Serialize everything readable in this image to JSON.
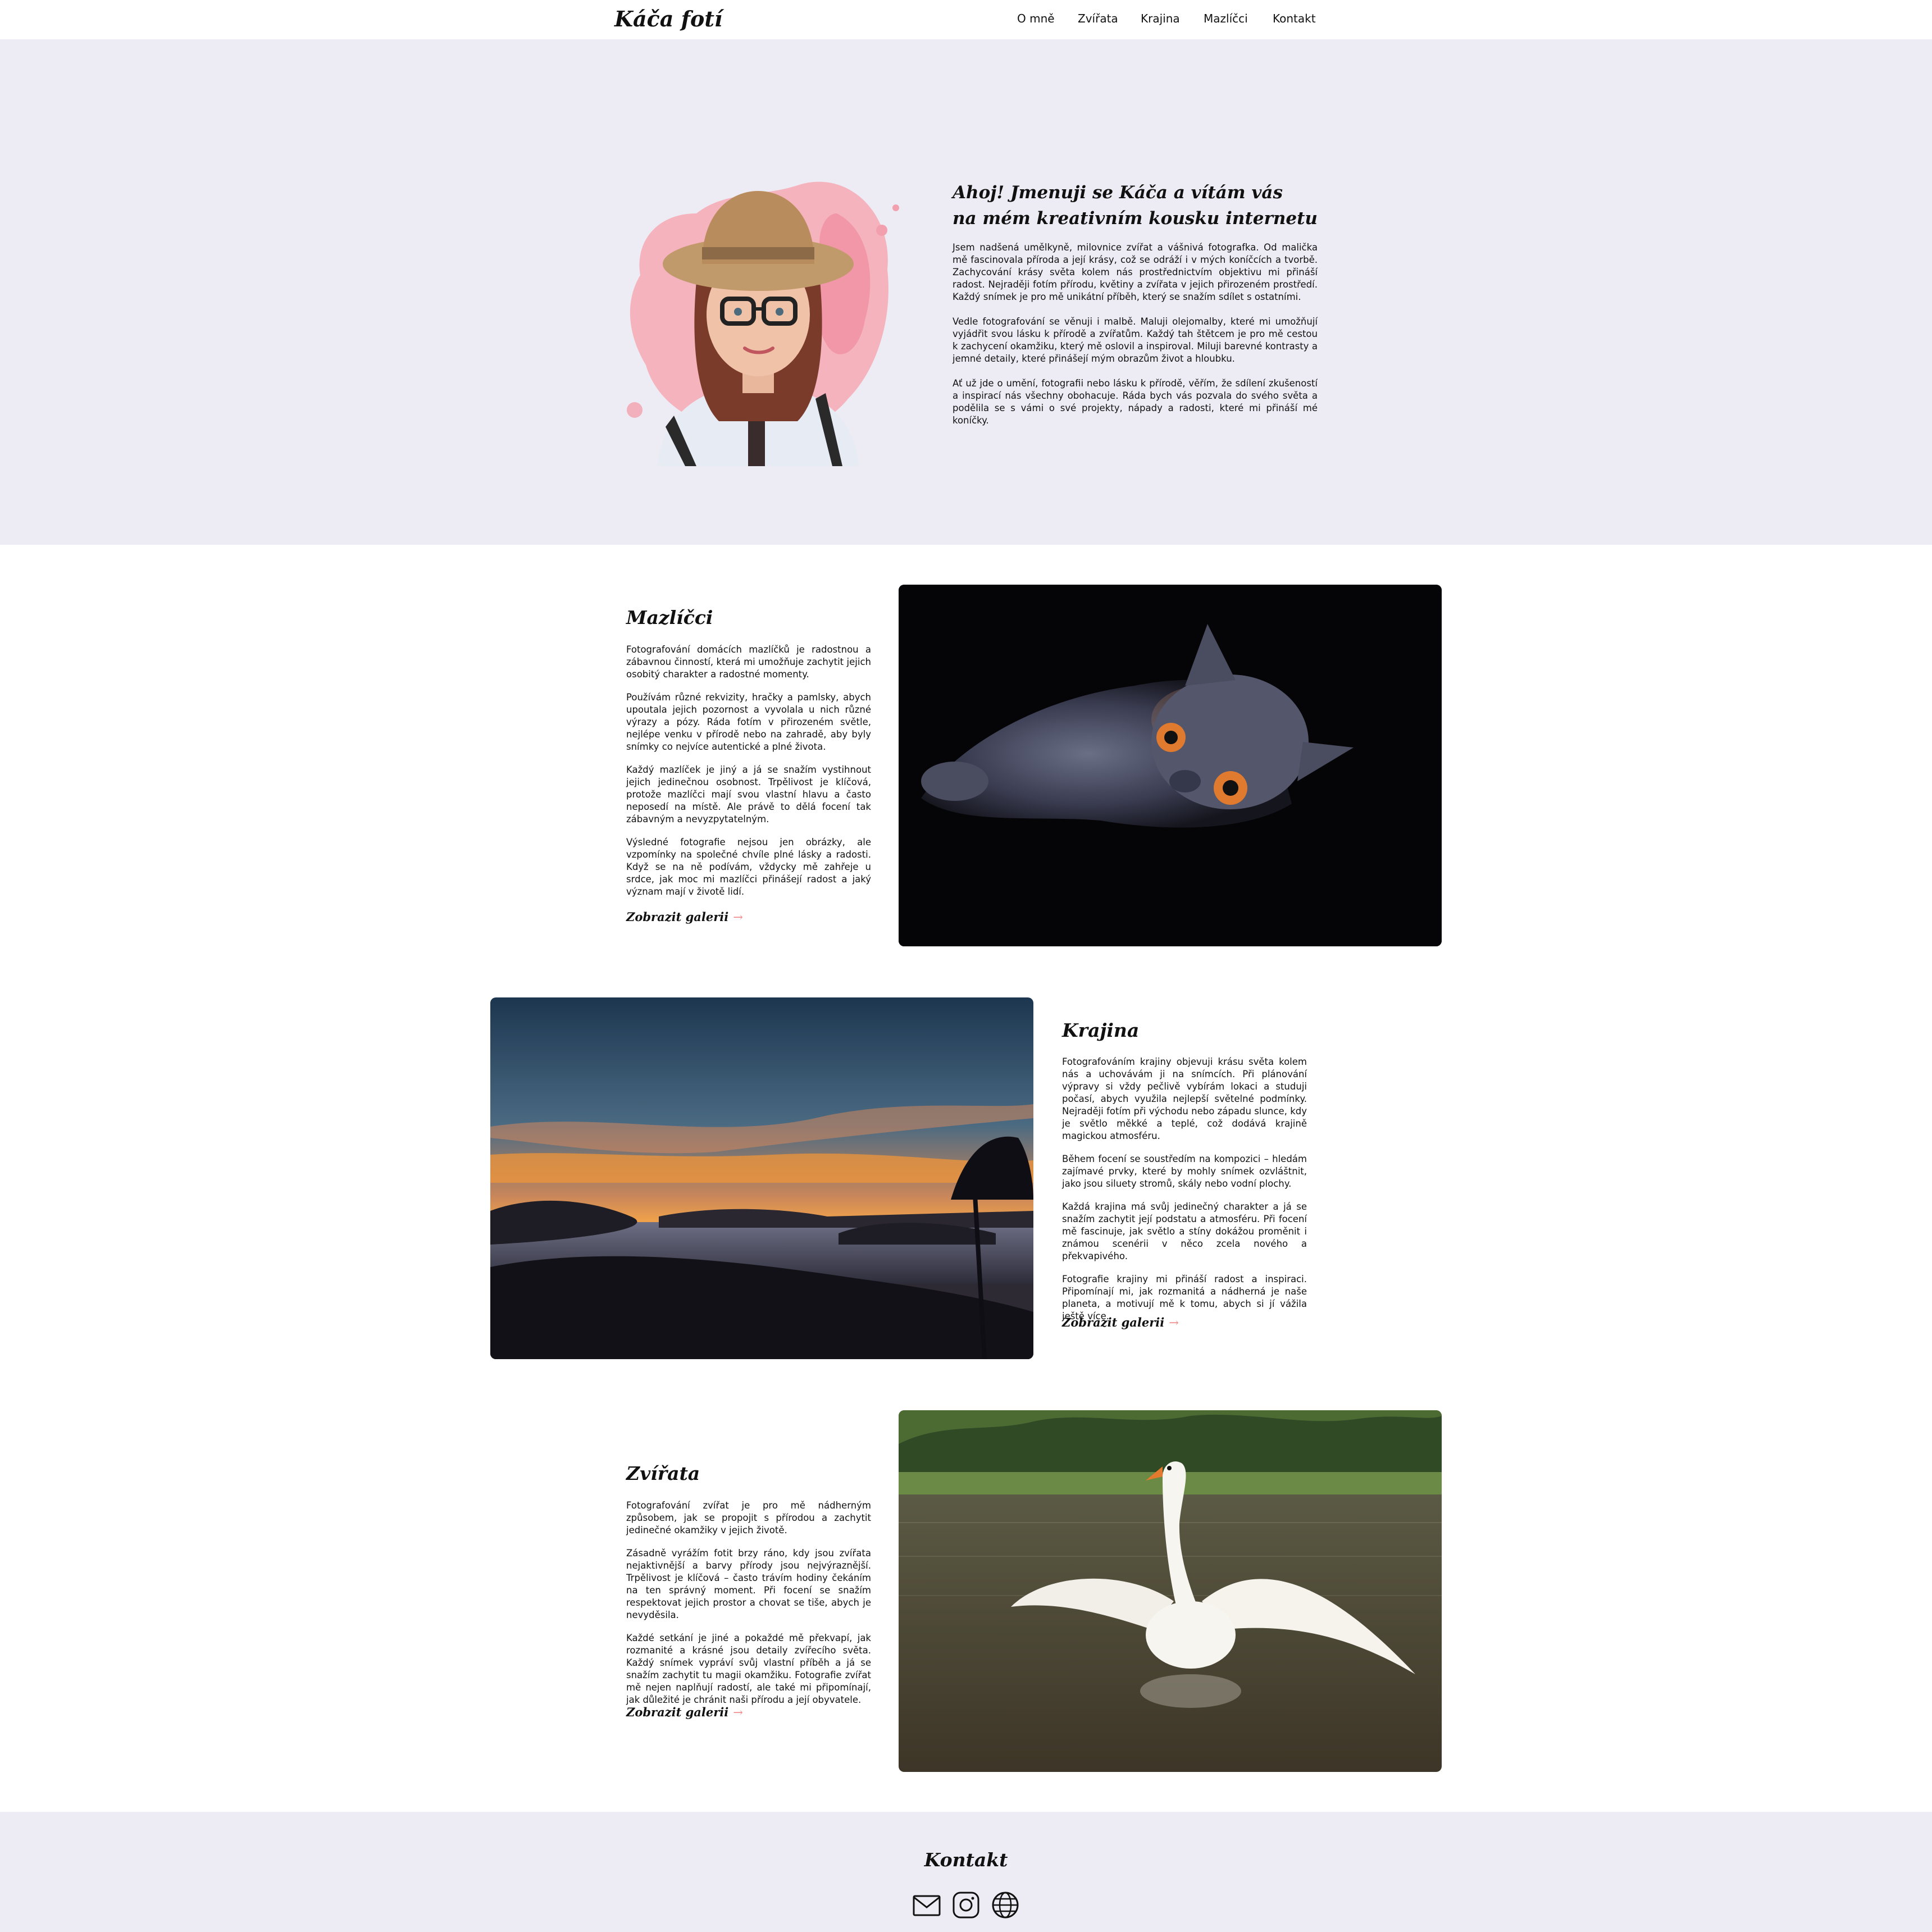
{
  "header": {
    "logo": "Káča fotí",
    "nav": [
      "O mně",
      "Zvířata",
      "Krajina",
      "Mazlíčci",
      "Kontakt"
    ]
  },
  "hero": {
    "title_line1": "Ahoj! Jmenuji se Káča a vítám vás",
    "title_line2": "na mém kreativním kousku internetu",
    "paragraphs": [
      "Jsem nadšená umělkyně, milovnice zvířat a vášnivá fotografka. Od malička mě fascinovala příroda a její krásy, což se odráží i v mých koníčcích a tvorbě. Zachycování krásy světa kolem nás prostřednictvím objektivu mi přináší radost. Nejraději fotím přírodu, květiny a zvířata v jejich přirozeném prostředí. Každý snímek je pro mě unikátní příběh, který se snažím sdílet s ostatními.",
      "Vedle fotografování se věnuji i malbě. Maluji olejomalby, které mi umožňují vyjádřit svou lásku k přírodě a zvířatům. Každý tah štětcem je pro mě cestou k zachycení okamžiku, který mě oslovil a inspiroval. Miluji barevné kontrasty a jemné detaily, které přinášejí mým obrazům život a hloubku.",
      "Ať už jde o umění, fotografii nebo lásku k přírodě, věřím, že sdílení zkušeností a inspirací nás všechny obohacuje. Ráda bych vás pozvala do svého světa a podělila se s vámi o své projekty, nápady a radosti, které mi přináší mé koníčky."
    ]
  },
  "sections": {
    "pets": {
      "title": "Mazlíčci",
      "paragraphs": [
        "Fotografování domácích mazlíčků je radostnou a zábavnou činností, která mi umožňuje zachytit jejich osobitý charakter a radostné momenty.",
        "Používám různé rekvizity, hračky a pamlsky, abych upoutala jejich pozornost a vyvolala u nich různé výrazy a pózy. Ráda fotím v přirozeném světle, nejlépe venku v přírodě nebo na zahradě, aby byly snímky co nejvíce autentické a plné života.",
        "Každý mazlíček je jiný a já se snažím vystihnout jejich jedinečnou osobnost. Trpělivost je klíčová, protože mazlíčci mají svou vlastní hlavu a často neposedí na místě. Ale právě to dělá focení tak zábavným a nevyzpytatelným.",
        "Výsledné fotografie nejsou jen obrázky, ale vzpomínky na společné chvíle plné lásky a radosti. Když se na ně podívám, vždycky mě zahřeje u srdce, jak moc mi mazlíčci přinášejí radost a jaký význam mají v životě lidí."
      ],
      "link": "Zobrazit galerii"
    },
    "landscape": {
      "title": "Krajina",
      "paragraphs": [
        "Fotografováním krajiny objevuji krásu světa kolem nás a uchovávám ji na snímcích. Při plánování výpravy si vždy pečlivě vybírám lokaci a studuji počasí, abych využila nejlepší světelné podmínky. Nejraději fotím při východu nebo západu slunce, kdy je světlo měkké a teplé, což dodává krajině magickou atmosféru.",
        "Během focení se soustředím na kompozici – hledám zajímavé prvky, které by mohly snímek ozvláštnit, jako jsou siluety stromů, skály nebo vodní plochy.",
        "Každá krajina má svůj jedinečný charakter a já se snažím zachytit její podstatu a atmosféru. Při focení mě fascinuje, jak světlo a stíny dokážou proměnit i známou scenérii v něco zcela nového a překvapivého.",
        "Fotografie krajiny mi přináší radost a inspiraci. Připomínají mi, jak rozmanitá a nádherná je naše planeta, a motivují mě k tomu, abych si jí vážila ještě více."
      ],
      "link": "Zobrazit galerii"
    },
    "animals": {
      "title": "Zvířata",
      "paragraphs": [
        "Fotografování zvířat je pro mě nádherným způsobem, jak se propojit s přírodou a zachytit jedinečné okamžiky v jejich životě.",
        "Zásadně vyrážím fotit brzy ráno, kdy jsou zvířata nejaktivnější a barvy přírody jsou nejvýraznější. Trpělivost je klíčová – často trávím hodiny čekáním na ten správný moment. Při focení se snažím respektovat jejich prostor a chovat se tiše, abych je nevyděsila.",
        "Každé setkání je jiné a pokaždé mě překvapí, jak rozmanité a krásné jsou detaily zvířecího světa. Každý snímek vypráví svůj vlastní příběh a já se snažím zachytit tu magii okamžiku. Fotografie zvířat mě nejen naplňují radostí, ale také mi připomínají, jak důležité je chránit naši přírodu a její obyvatele."
      ],
      "link": "Zobrazit galerii"
    }
  },
  "footer": {
    "title": "Kontakt",
    "icons": [
      "mail-icon",
      "instagram-icon",
      "globe-icon"
    ]
  }
}
